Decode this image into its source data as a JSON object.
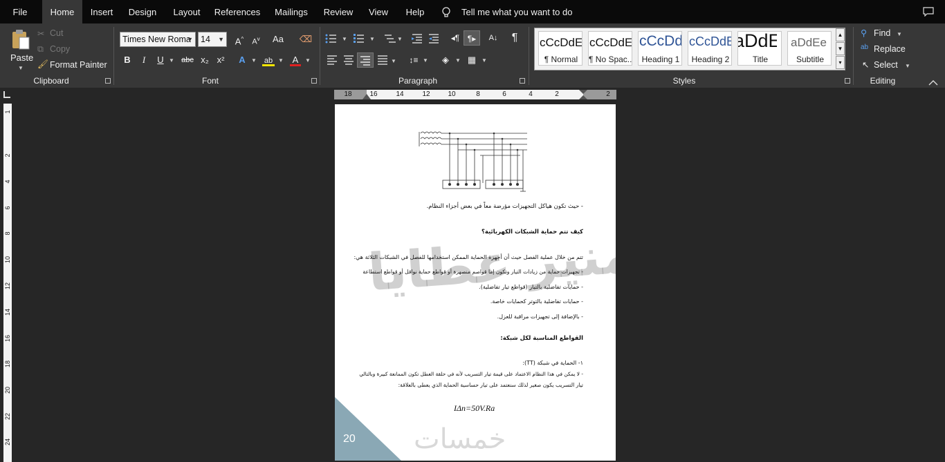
{
  "menu": {
    "tabs": [
      "File",
      "Home",
      "Insert",
      "Design",
      "Layout",
      "References",
      "Mailings",
      "Review",
      "View",
      "Help"
    ],
    "active_tab": "Home",
    "tell_me": "Tell me what you want to do"
  },
  "ribbon": {
    "clipboard": {
      "label": "Clipboard",
      "paste": "Paste",
      "cut": "Cut",
      "copy": "Copy",
      "format_painter": "Format Painter"
    },
    "font": {
      "label": "Font",
      "font_name": "Times New Roma",
      "font_size": "14",
      "bold": "B",
      "italic": "I",
      "underline": "U",
      "strikethrough": "abc",
      "subscript": "x₂",
      "superscript": "x²",
      "grow": "A",
      "shrink": "A",
      "change_case": "Aa",
      "font_color": "A",
      "highlight_color": "#f5e500",
      "font_color_bar": "#e02020"
    },
    "paragraph": {
      "label": "Paragraph",
      "show_marks": "¶"
    },
    "styles": {
      "label": "Styles",
      "items": [
        {
          "preview": "cCcDdEe",
          "name": "¶ Normal",
          "color": "#111111"
        },
        {
          "preview": "cCcDdEe",
          "name": "¶ No Spac...",
          "color": "#111111"
        },
        {
          "preview": "cCcDdEe",
          "name": "Heading 1",
          "color": "#2f5496"
        },
        {
          "preview": "cCcDdEe",
          "name": "Heading 2",
          "color": "#2f5496"
        },
        {
          "preview": "aDdEe",
          "name": "Title",
          "color": "#111111"
        },
        {
          "preview": "aDdEe",
          "name": "Subtitle",
          "color": "#666666"
        }
      ]
    },
    "editing": {
      "label": "Editing",
      "find": "Find",
      "replace": "Replace",
      "select": "Select"
    }
  },
  "ruler": {
    "h_numbers": [
      "18",
      "16",
      "14",
      "12",
      "10",
      "8",
      "6",
      "4",
      "2",
      "2"
    ],
    "v_numbers": [
      "1",
      "2",
      "4",
      "6",
      "8",
      "10",
      "12",
      "14",
      "16",
      "18",
      "20",
      "22",
      "24"
    ]
  },
  "document": {
    "paragraphs": [
      "- حيث تكون هياكل التجهيزات مؤرضة معاً في بعض أجزاء النظام.",
      "كيف تتم حماية الشبكات الكهربائية؟",
      "تتم من خلال عملية الفصل حيث أن أجهزة الحماية الممكن استخدامها للفصل في الشبكات الثلاثة هي:",
      "- تجهيزات حماية من زيادات التيار وتكون إما قواصم منصهرة أو قواطع حماية نواقل أو قواطع استطاعة",
      "- حمايات تفاضلية بالتيار (قواطع تيار تفاضلية).",
      "- حمايات تفاضلية بالتوتر كحمايات خاصة.",
      "- بالإضافة إلى تجهيزات مراقبة للعزل.",
      "القواطع المناسبة لكل شبكة:",
      "١- الحماية في شبكة (TT):",
      "- لا يمكن في هذا النظام الاعتماد على قيمة تيار التسريب لأنه في حلقة العطل تكون الممانعة كبيرة وبالتالي",
      "تيار التسريب يكون صغير لذلك سنعتمد على تيار حساسية الحماية الذي يعطى بالعلاقة:"
    ],
    "formula": "IΔn=50V.Ra",
    "watermark": "منير عطايا",
    "page_number": "20",
    "footer_logo": "خمسات",
    "corner_color": "#8aa8b5"
  }
}
